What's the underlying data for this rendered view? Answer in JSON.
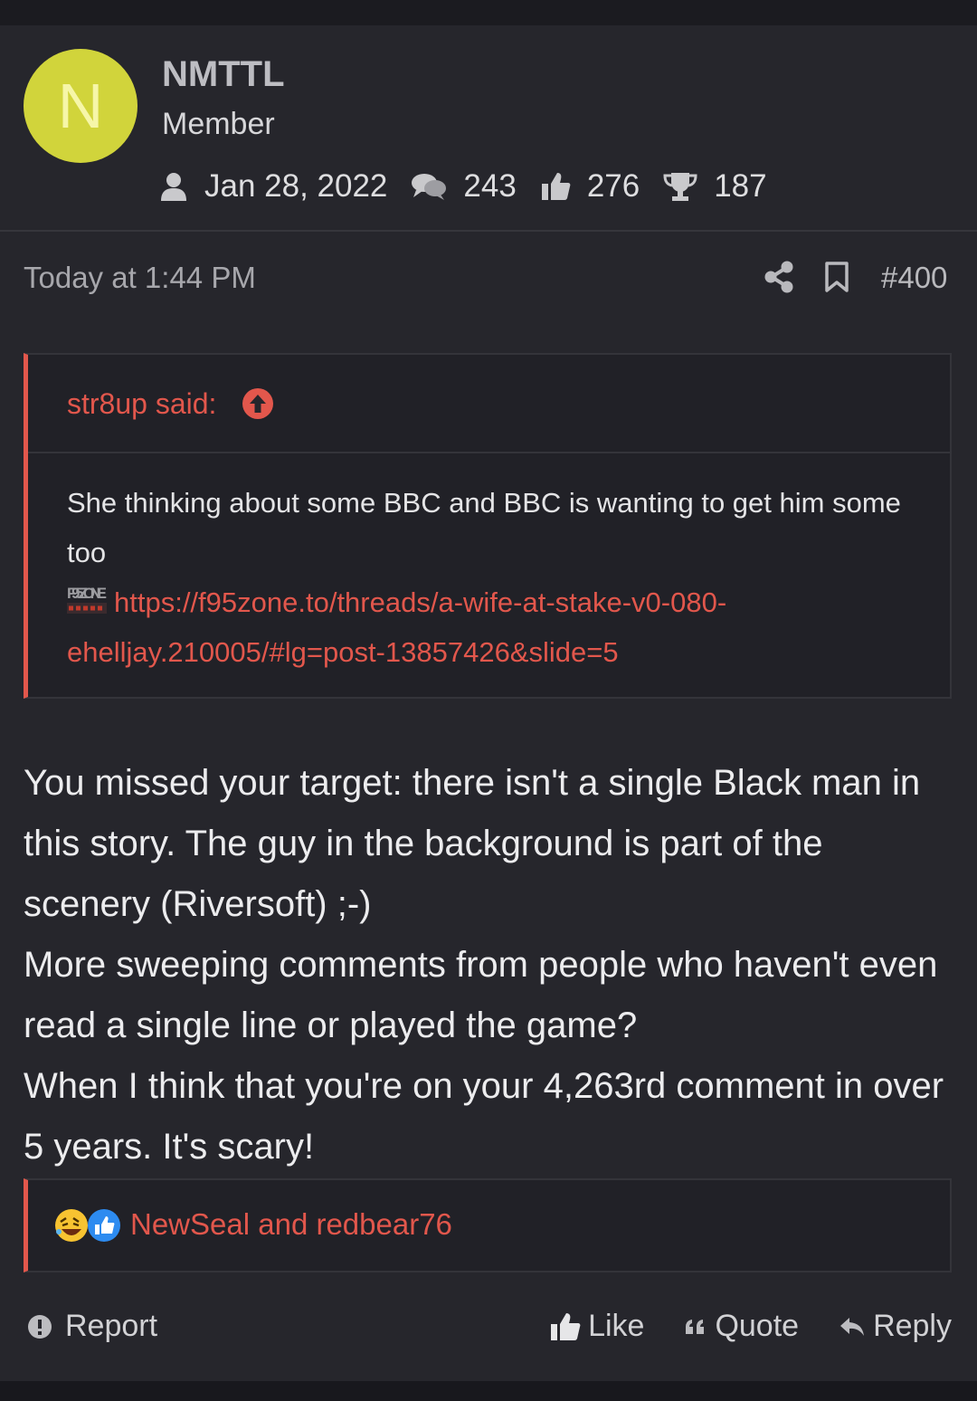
{
  "user": {
    "avatar_letter": "N",
    "avatar_color": "#d1d43b",
    "name": "NMTTL",
    "title": "Member",
    "stats": {
      "joined": "Jan 28, 2022",
      "messages": "243",
      "reactions": "276",
      "points": "187"
    },
    "stat_icons": [
      "user-icon",
      "comments-icon",
      "thumbs-up-icon",
      "trophy-icon"
    ]
  },
  "post": {
    "date": "Today at 1:44 PM",
    "number": "#400",
    "quote": {
      "author": "str8up said:",
      "text": "She thinking about some BBC and BBC is wanting to get him some too",
      "link_badge": "F95 ZONE",
      "link": "https://f95zone.to/threads/a-wife-at-stake-v0-080-ehelljay.210005/#lg=post-13857426&slide=5"
    },
    "message": [
      "You missed your target: there isn't a single Black man in this story. The guy in the background is part of the scenery (Riversoft) ;-)",
      "More sweeping comments from people who haven't even read a single line or played the game?",
      "When I think that you're on your 4,263rd comment in over 5 years. It's scary!"
    ],
    "reactions": {
      "icons": [
        "laughing-emoji-icon",
        "like-reaction-icon"
      ],
      "text": "NewSeal and redbear76"
    }
  },
  "actions": {
    "report": "Report",
    "like": "Like",
    "quote": "Quote",
    "reply": "Reply"
  },
  "colors": {
    "accent": "#e2574c",
    "background": "#26262c"
  }
}
